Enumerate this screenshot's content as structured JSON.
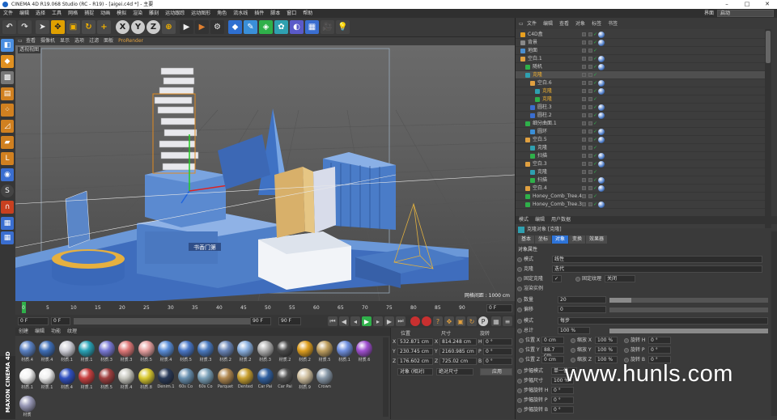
{
  "window": {
    "title": "CINEMA 4D R19.068 Studio (RC - R19) - [aigei.c4d *] - 主要",
    "layout_label": "界面",
    "layout_value": "启动"
  },
  "menu": [
    "文件",
    "编辑",
    "选择",
    "工具",
    "网格",
    "捕捉",
    "动画",
    "模拟",
    "渲染",
    "雕刻",
    "运动跟踪",
    "运动图形",
    "角色",
    "流水线",
    "插件",
    "脚本",
    "窗口",
    "帮助"
  ],
  "toolbar": {
    "undo": "undo-icon",
    "axes": [
      "X",
      "Y",
      "Z"
    ]
  },
  "view_menu": [
    "查看",
    "摄像机",
    "显示",
    "选项",
    "过滤",
    "面板",
    "ProRender"
  ],
  "viewport": {
    "label": "透视视图",
    "grid_info": "网格间距 : 1000 cm"
  },
  "timeline": {
    "ticks": [
      "0",
      "5",
      "10",
      "15",
      "20",
      "25",
      "30",
      "35",
      "40",
      "45",
      "50",
      "55",
      "60",
      "65",
      "70",
      "75",
      "80",
      "85",
      "90"
    ],
    "frame_display": "0 F"
  },
  "transport": {
    "start": "0 F",
    "current": "0 F",
    "end": "90 F",
    "max": "90 F"
  },
  "material_menu": [
    "创建",
    "编辑",
    "功能",
    "纹理"
  ],
  "materials": [
    {
      "name": "材质.4",
      "color": "#5b82c4"
    },
    {
      "name": "材质.4",
      "color": "#3f6fb8"
    },
    {
      "name": "材质.1",
      "color": "#d0d0d8"
    },
    {
      "name": "材质.1",
      "color": "#2aa4b8"
    },
    {
      "name": "材质.3",
      "color": "#7a7ad6"
    },
    {
      "name": "材质.3",
      "color": "#e07878"
    },
    {
      "name": "材质.5",
      "color": "#e6a0a0"
    },
    {
      "name": "材质.4",
      "color": "#5a8ed8"
    },
    {
      "name": "材质.5",
      "color": "#4a78c8"
    },
    {
      "name": "材质.3",
      "color": "#4a7ac0"
    },
    {
      "name": "材质.2",
      "color": "#6a86b8"
    },
    {
      "name": "材质.2",
      "color": "#8ab0e0"
    },
    {
      "name": "材质.3",
      "color": "#b0b0b0"
    },
    {
      "name": "材质.2",
      "color": "#4a4a4a"
    },
    {
      "name": "材质.2",
      "color": "#e0a020"
    },
    {
      "name": "材质.5",
      "color": "#c0a060"
    },
    {
      "name": "材质.1",
      "color": "#7090e0"
    },
    {
      "name": "材质.6",
      "color": "#a050d0"
    },
    {
      "name": "材质.1",
      "color": "#f4f4f4"
    },
    {
      "name": "材质.1",
      "color": "#f0f0f0"
    },
    {
      "name": "材质.4",
      "color": "#3050c0"
    },
    {
      "name": "材质.1",
      "color": "#c84040"
    },
    {
      "name": "材质.5",
      "color": "#a04040"
    },
    {
      "name": "材质.4",
      "color": "#c8c8c0"
    },
    {
      "name": "材质.8",
      "color": "#d8c830"
    },
    {
      "name": "Denim.1",
      "color": "#2a3a58"
    },
    {
      "name": "60s Co",
      "color": "#6890b0"
    },
    {
      "name": "60s Co",
      "color": "#7aa0b8"
    },
    {
      "name": "Parquet",
      "color": "#b08850"
    },
    {
      "name": "Dented",
      "color": "#c8a030"
    },
    {
      "name": "Car Pai",
      "color": "#3060a0"
    },
    {
      "name": "Car Pai",
      "color": "#505050"
    },
    {
      "name": "材质.9",
      "color": "#d0c0a0"
    },
    {
      "name": "Crown",
      "color": "#8898a8"
    },
    {
      "name": "材质",
      "color": "#9a9ab8"
    }
  ],
  "coords": {
    "headers": [
      "位置",
      "尺寸",
      "旋转"
    ],
    "rows": [
      {
        "axis": "X",
        "pos": "532.871 cm",
        "size_axis": "X",
        "size": "814.248 cm",
        "rot_axis": "H",
        "rot": "0 °"
      },
      {
        "axis": "Y",
        "pos": "230.745 cm",
        "size_axis": "Y",
        "size": "2160.985 cm",
        "rot_axis": "P",
        "rot": "0 °"
      },
      {
        "axis": "Z",
        "pos": "176.602 cm",
        "size_axis": "Z",
        "size": "725.02 cm",
        "rot_axis": "B",
        "rot": "0 °"
      }
    ],
    "mode": "对象 (相对)",
    "size_mode": "绝对尺寸",
    "apply": "应用"
  },
  "object_manager": {
    "tabs": [
      "文件",
      "编辑",
      "查看",
      "对象",
      "标签",
      "书签"
    ],
    "objects": [
      {
        "name": "C4D盒",
        "indent": 0
      },
      {
        "name": "背景",
        "indent": 0
      },
      {
        "name": "地面",
        "indent": 0
      },
      {
        "name": "空白.1",
        "indent": 0
      },
      {
        "name": "随机",
        "indent": 1
      },
      {
        "name": "克隆",
        "indent": 1
      },
      {
        "name": "空白.6",
        "indent": 2
      },
      {
        "name": "克隆",
        "indent": 3
      },
      {
        "name": "克隆",
        "indent": 3
      },
      {
        "name": "圆柱.3",
        "indent": 2
      },
      {
        "name": "圆柱.2",
        "indent": 2
      },
      {
        "name": "细分曲面.1",
        "indent": 1
      },
      {
        "name": "圆环",
        "indent": 2
      },
      {
        "name": "空白.5",
        "indent": 1
      },
      {
        "name": "克隆",
        "indent": 2
      },
      {
        "name": "扫描",
        "indent": 2
      },
      {
        "name": "空白.3",
        "indent": 1
      },
      {
        "name": "克隆",
        "indent": 2
      },
      {
        "name": "扫描",
        "indent": 2
      },
      {
        "name": "空白.4",
        "indent": 1
      },
      {
        "name": "Honey_Comb_Tree.4",
        "indent": 1
      },
      {
        "name": "Honey_Comb_Tree.3",
        "indent": 1
      }
    ]
  },
  "attributes": {
    "tabs": [
      "模式",
      "编辑",
      "用户数据"
    ],
    "header": "克隆对象 [克隆]",
    "subtabs": [
      "基本",
      "坐标",
      "对象",
      "变换",
      "效果器"
    ],
    "section": "对象属性",
    "rows": [
      {
        "k": "模式",
        "v": "线性"
      },
      {
        "k": "克隆",
        "v": "迭代"
      },
      {
        "k": "固定克隆",
        "v": "✓"
      },
      {
        "k": "固定纹理",
        "v": "关闭"
      },
      {
        "k": "渲染实例",
        "v": ""
      },
      {
        "k": "数量",
        "v": "20"
      },
      {
        "k": "偏移",
        "v": "0"
      },
      {
        "k": "模式",
        "v": "每步"
      },
      {
        "k": "总计",
        "v": "100 %"
      },
      {
        "k": "位置 X",
        "v": "0 cm"
      },
      {
        "k": "缩放 X",
        "v": "100 %"
      },
      {
        "k": "旋转 H",
        "v": "0 °"
      },
      {
        "k": "位置 Y",
        "v": "88.7 cm"
      },
      {
        "k": "缩放 Y",
        "v": "100 %"
      },
      {
        "k": "旋转 P",
        "v": "0 °"
      },
      {
        "k": "位置 Z",
        "v": "0 cm"
      },
      {
        "k": "缩放 Z",
        "v": "100 %"
      },
      {
        "k": "旋转 B",
        "v": "0 °"
      },
      {
        "k": "步幅模式",
        "v": "单一值"
      },
      {
        "k": "步幅尺寸",
        "v": "100 %"
      },
      {
        "k": "步幅旋转 H",
        "v": "0 °"
      },
      {
        "k": "步幅旋转 P",
        "v": "0 °"
      },
      {
        "k": "步幅旋转 B",
        "v": "0 °"
      }
    ]
  },
  "scene": {
    "sign": "书香门第"
  },
  "watermark": "www.hunls.com",
  "brand": "MAXON CINEMA 4D"
}
